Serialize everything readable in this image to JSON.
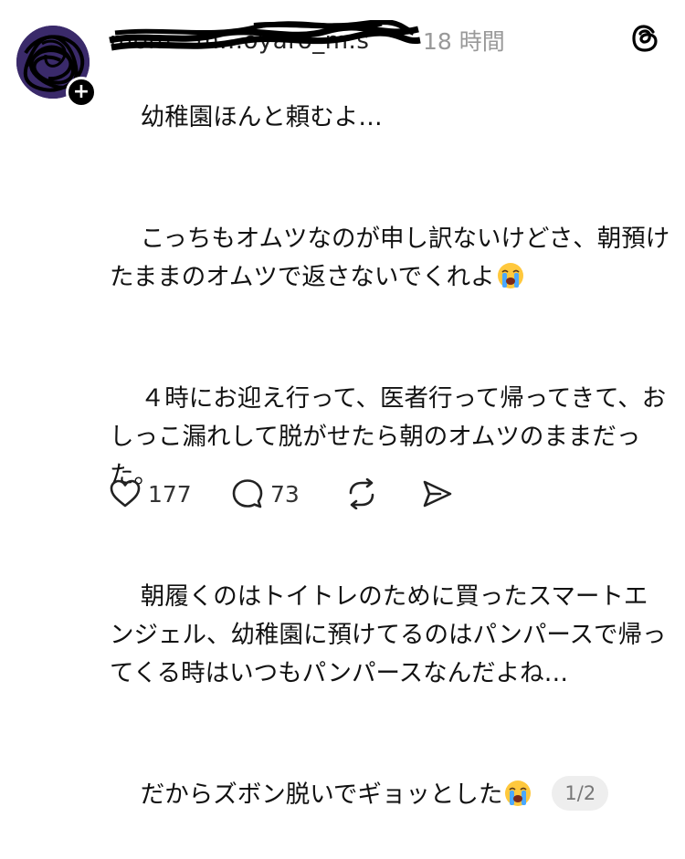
{
  "post": {
    "username": "mom...m...oyaro_m.s",
    "timestamp": "18 時間",
    "paragraphs": [
      "幼稚園ほんと頼むよ…",
      "こっちもオムツなのが申し訳ないけどさ、朝預けたままのオムツで返さないでくれよ",
      "４時にお迎え行って、医者行って帰ってきて、おしっこ漏れして脱がせたら朝のオムツのままだった。",
      "朝履くのはトイトレのために買ったスマートエンジェル、幼稚園に預けてるのはパンパースで帰ってくる時はいつもパンパースなんだよね…",
      "だからズボン脱いでギョッとした"
    ],
    "page_indicator": "1/2"
  },
  "actions": {
    "like_count": "177",
    "comment_count": "73"
  },
  "icons": {
    "avatar": "avatar",
    "follow": "plus-icon",
    "app": "threads-icon",
    "emoji": "loudly-crying-face-icon",
    "like": "heart-icon",
    "comment": "comment-icon",
    "repost": "repost-icon",
    "share": "send-icon"
  },
  "colors": {
    "text": "#111111",
    "meta": "#999999",
    "pill_bg": "#eeeeee"
  }
}
